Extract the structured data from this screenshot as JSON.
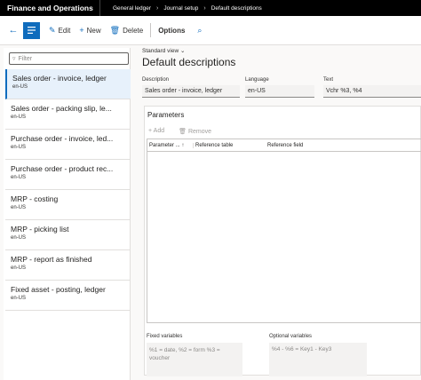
{
  "app": {
    "title": "Finance and Operations"
  },
  "breadcrumb": [
    "General ledger",
    "Journal setup",
    "Default descriptions"
  ],
  "toolbar": {
    "edit": "Edit",
    "new": "New",
    "delete": "Delete",
    "options": "Options"
  },
  "filter": {
    "placeholder": "Filter"
  },
  "list": [
    {
      "name": "Sales order - invoice, ledger",
      "lang": "en-US"
    },
    {
      "name": "Sales order - packing slip, le...",
      "lang": "en-US"
    },
    {
      "name": "Purchase order - invoice, led...",
      "lang": "en-US"
    },
    {
      "name": "Purchase order - product rec...",
      "lang": "en-US"
    },
    {
      "name": "MRP - costing",
      "lang": "en-US"
    },
    {
      "name": "MRP - picking list",
      "lang": "en-US"
    },
    {
      "name": "MRP - report as finished",
      "lang": "en-US"
    },
    {
      "name": "Fixed asset - posting, ledger",
      "lang": "en-US"
    }
  ],
  "main": {
    "view": "Standard view",
    "title": "Default descriptions",
    "description_label": "Description",
    "description_value": "Sales order - invoice, ledger",
    "language_label": "Language",
    "language_value": "en-US",
    "text_label": "Text",
    "text_value": "Vchr %3, %4"
  },
  "params": {
    "title": "Parameters",
    "add": "Add",
    "remove": "Remove",
    "columns": [
      "Parameter ...",
      "Reference table",
      "Reference field"
    ],
    "fixed_label": "Fixed variables",
    "fixed_value": "%1 = date, %2 = form %3 = voucher",
    "optional_label": "Optional variables",
    "optional_value": "%4 - %6 = Key1 - Key3"
  },
  "colors": {
    "accent": "#0f6cbd",
    "topbar": "#000000",
    "selected": "#e7f1fb"
  }
}
